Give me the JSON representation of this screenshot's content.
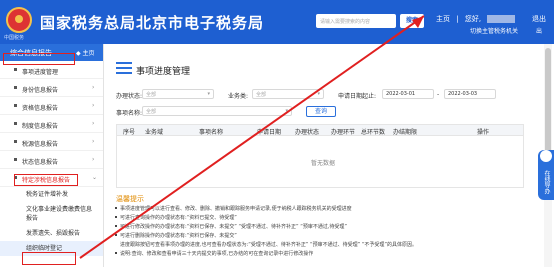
{
  "header": {
    "app_title": "国家税务总局北京市电子税务局",
    "logo_sub": "中国税务",
    "search_placeholder": "请输入需要搜索的内容",
    "search_button": "搜索",
    "home_link": "主页",
    "greeting": "您好,",
    "logout": "退出",
    "switch_role": "切换主管税务机关",
    "exit_short": "出"
  },
  "sidebar": {
    "title": "综合信息报告",
    "home": "◆ 主页",
    "items": [
      {
        "label": "事项进度管理"
      },
      {
        "label": "身份信息报告"
      },
      {
        "label": "资格信息报告"
      },
      {
        "label": "制度信息报告"
      },
      {
        "label": "税源信息报告"
      },
      {
        "label": "状态信息报告"
      },
      {
        "label": "特定涉税信息报告"
      }
    ],
    "subitems": [
      {
        "label": "税务证件增补发"
      },
      {
        "label": "文化事业建设费缴费信息报告"
      },
      {
        "label": "发票遗失、损毁报告"
      },
      {
        "label": "组织临时登记"
      }
    ]
  },
  "main": {
    "page_title": "事项进度管理",
    "filters": {
      "matter_name_label": "办理状态:",
      "matter_name_value": "全部",
      "business_label": "业务类:",
      "business_value": "全部",
      "date_label": "申请日期起止:",
      "date_start": "2022-03-01",
      "date_sep": "-",
      "date_end": "2022-03-03",
      "item_name_label": "事项名称:",
      "item_name_value": "全部",
      "query_button": "查询"
    },
    "columns": [
      "序号",
      "业务域",
      "事项名称",
      "申请日期",
      "办理状态",
      "办理环节",
      "总环节数",
      "办结期限",
      "操作"
    ],
    "no_data": "暂无数据",
    "tips_title": "温馨提示",
    "tips": [
      "事项进度管理可以进行查看、修改、删除、撤销和跟踪服务申请记录,便于纳税人跟踪税务机关的受理进度",
      "可进行查询操作的办理状态有:“资料已提交、待受理”",
      "可进行修改操作的办理状态有:“资料已保存、未提交” “受理不通过、待补齐补正” “预审不通过,待受理”",
      "可进行删除操作的办理状态有:“资料已保存、未提交”",
      "进度跟踪按钮可查看事项办理的进度,也可查看办理状态为:“受理不通过、待补齐补正” “预审不通过、待受理” “不予受理”的具体原因。",
      "说明:查询、修改和查看申请三十天内提交的事项,已办结的可在查询记录中进行修改操作"
    ]
  },
  "float_tool": {
    "label": "在线导办"
  },
  "colors": {
    "header_blue": "#1e5fd1",
    "accent_blue": "#2a6fdb",
    "annotation_red": "#e02020",
    "tips_orange": "#e08a00"
  }
}
